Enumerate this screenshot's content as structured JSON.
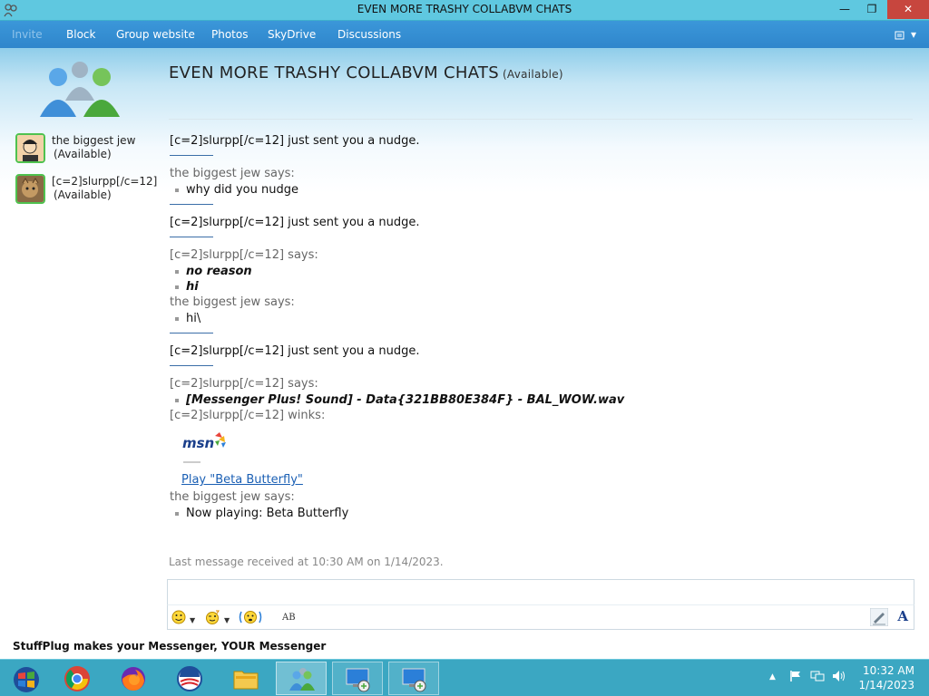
{
  "window": {
    "title": "EVEN MORE TRASHY COLLABVM CHATS",
    "min_glyph": "—",
    "max_glyph": "❐",
    "close_glyph": "✕"
  },
  "menu": {
    "items": [
      "Invite",
      "Block",
      "Group website",
      "Photos",
      "SkyDrive",
      "Discussions"
    ],
    "options_glyph": "▾"
  },
  "conversation": {
    "title": "EVEN MORE TRASHY COLLABVM CHATS",
    "status": "(Available)"
  },
  "contacts": [
    {
      "name": "the biggest jew",
      "status": "(Available)"
    },
    {
      "name": "[c=2]slurpp[/c=12]",
      "status": "(Available)"
    }
  ],
  "messages": [
    {
      "text": "[c=2]slurpp[/c=12] just sent you a nudge."
    },
    {
      "text": "the biggest jew says:"
    },
    {
      "text": "why did you nudge"
    },
    {
      "text": "[c=2]slurpp[/c=12] just sent you a nudge."
    },
    {
      "text": "[c=2]slurpp[/c=12] says:"
    },
    {
      "text": "no reason"
    },
    {
      "text": "hi"
    },
    {
      "text": "the biggest jew says:"
    },
    {
      "text": "hi\\"
    },
    {
      "text": "[c=2]slurpp[/c=12] just sent you a nudge."
    },
    {
      "text": "[c=2]slurpp[/c=12] says:"
    },
    {
      "text": "[Messenger Plus! Sound] - Data{321BB80E384F} - BAL_WOW.wav"
    },
    {
      "text": "[c=2]slurpp[/c=12] winks:"
    },
    {
      "text": "the biggest jew says:"
    },
    {
      "text": "Now playing: Beta Butterfly"
    }
  ],
  "wink": {
    "logo_text": "msn",
    "play_link": "Play \"Beta Butterfly\""
  },
  "last_message": "Last message received at 10:30 AM on 1/14/2023.",
  "input": {
    "value": "",
    "font_glyph": "A",
    "spell_glyph": "AB"
  },
  "ad": "StuffPlug makes your Messenger, YOUR Messenger",
  "taskbar": {
    "items": [
      "start-button",
      "chrome",
      "firefox",
      "obama-logo",
      "file-explorer",
      "messenger",
      "remote-desktop-1",
      "remote-desktop-2"
    ],
    "tray_arrow": "▲",
    "time": "10:32 AM",
    "date": "1/14/2023"
  },
  "colors": {
    "titlebar": "#5fc8e0",
    "menubar": "#3b97d9",
    "taskbar": "#3ba7c2",
    "close": "#c7463e",
    "link": "#1a5fb4"
  }
}
